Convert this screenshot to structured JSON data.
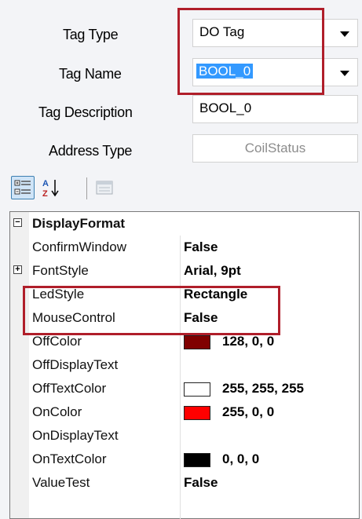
{
  "form": {
    "tag_type": {
      "label": "Tag Type",
      "value": "DO Tag"
    },
    "tag_name": {
      "label": "Tag Name",
      "value": "BOOL_0"
    },
    "tag_description": {
      "label": "Tag Description",
      "value": "BOOL_0"
    },
    "address_type": {
      "label": "Address Type",
      "value": "CoilStatus"
    }
  },
  "toolbar": {
    "categorized_icon": "categorized-view-icon",
    "alphabetical_icon": "sort-alphabetical-icon",
    "property_pages_icon": "property-pages-icon"
  },
  "grid": {
    "category": {
      "toggle": "−",
      "label": "DisplayFormat"
    },
    "rows": [
      {
        "name": "ConfirmWindow",
        "value": "False"
      },
      {
        "name": "FontStyle",
        "value": "Arial, 9pt",
        "toggle": "+"
      },
      {
        "name": "LedStyle",
        "value": "Rectangle"
      },
      {
        "name": "MouseControl",
        "value": "False"
      },
      {
        "name": "OffColor",
        "value": "128, 0, 0",
        "swatch": "#800000"
      },
      {
        "name": "OffDisplayText",
        "value": ""
      },
      {
        "name": "OffTextColor",
        "value": "255, 255, 255",
        "swatch": "#ffffff"
      },
      {
        "name": "OnColor",
        "value": "255, 0, 0",
        "swatch": "#ff0000"
      },
      {
        "name": "OnDisplayText",
        "value": ""
      },
      {
        "name": "OnTextColor",
        "value": "0, 0, 0",
        "swatch": "#000000"
      },
      {
        "name": "ValueTest",
        "value": "False"
      }
    ]
  },
  "colors": {
    "highlight_box": "#b01e2a",
    "selection": "#3399ff"
  }
}
